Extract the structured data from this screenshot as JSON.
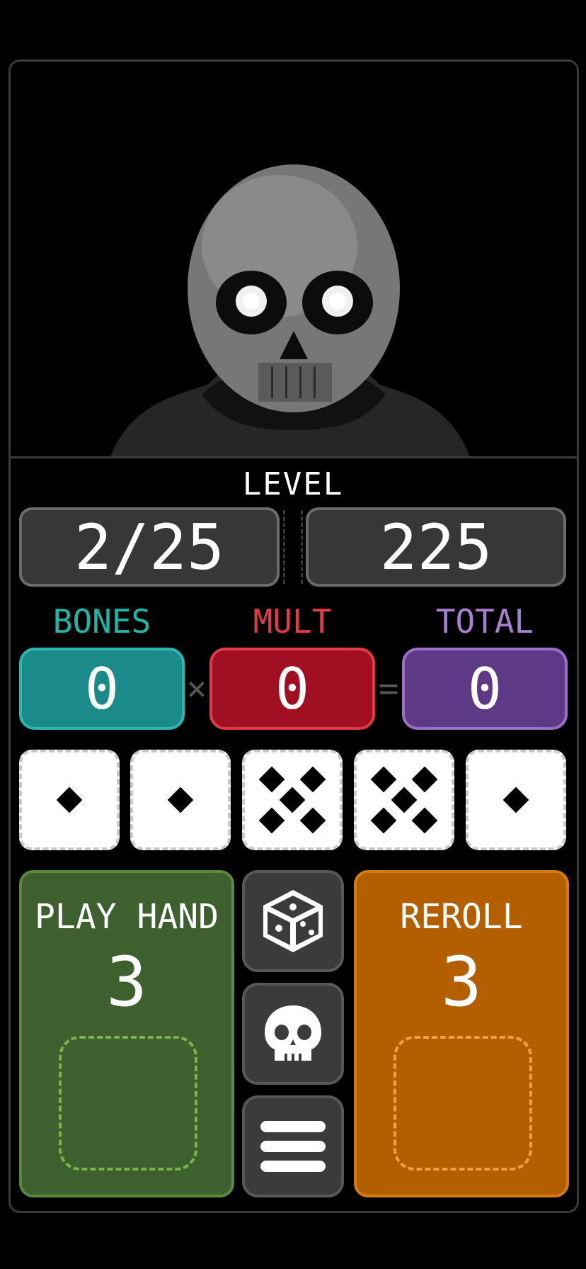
{
  "level": {
    "label": "LEVEL",
    "progress": "2/25",
    "target": "225"
  },
  "score": {
    "bones_label": "BONES",
    "bones_value": "0",
    "mult_label": "MULT",
    "mult_value": "0",
    "total_label": "TOTAL",
    "total_value": "0",
    "times_symbol": "×",
    "equals_symbol": "="
  },
  "dice": [
    1,
    1,
    5,
    5,
    1
  ],
  "actions": {
    "play_label": "PLAY HAND",
    "play_count": "3",
    "reroll_label": "REROLL",
    "reroll_count": "3"
  },
  "side_buttons": [
    "dice-icon",
    "skull-icon",
    "menu-icon"
  ],
  "colors": {
    "bones": "#1f9a9a",
    "mult": "#b01226",
    "total": "#6a3e8a",
    "play": "#3e5f2e",
    "reroll": "#b35f00"
  }
}
